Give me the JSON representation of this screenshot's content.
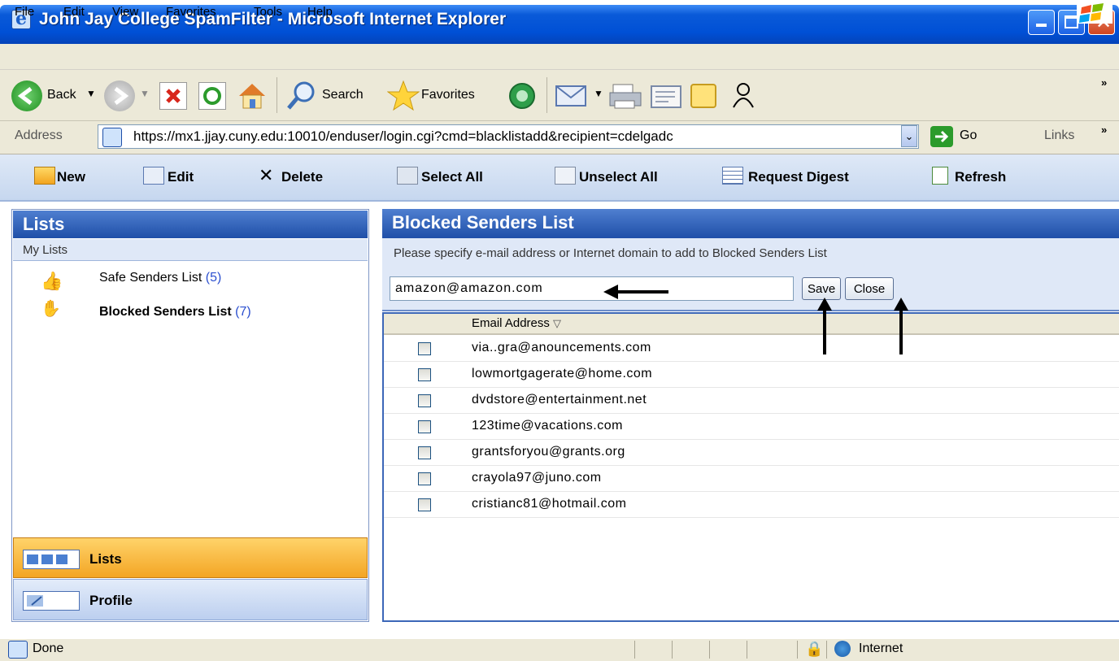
{
  "window": {
    "title": "John Jay College SpamFilter - Microsoft Internet Explorer"
  },
  "menu": [
    "File",
    "Edit",
    "View",
    "Favorites",
    "Tools",
    "Help"
  ],
  "toolbar": {
    "back": "Back",
    "search": "Search",
    "favorites": "Favorites"
  },
  "address": {
    "label": "Address",
    "url": "https://mx1.jjay.cuny.edu:10010/enduser/login.cgi?cmd=blacklistadd&recipient=cdelgadc",
    "go": "Go",
    "links": "Links"
  },
  "app_toolbar": {
    "new": "New",
    "edit": "Edit",
    "delete": "Delete",
    "select_all": "Select All",
    "unselect_all": "Unselect All",
    "request_digest": "Request Digest",
    "refresh": "Refresh"
  },
  "left": {
    "header": "Lists",
    "section": "My Lists",
    "safe_label": "Safe Senders List",
    "safe_count": "(5)",
    "blocked_label": "Blocked Senders List",
    "blocked_count": "(7)",
    "nav_lists": "Lists",
    "nav_profile": "Profile"
  },
  "right": {
    "header": "Blocked Senders List",
    "instructions": "Please specify e-mail address or Internet domain to add to Blocked Senders List",
    "input_value": "amazon@amazon.com",
    "save": "Save",
    "close": "Close",
    "column": "Email Address",
    "emails": [
      "via..gra@anouncements.com",
      "lowmortgagerate@home.com",
      "dvdstore@entertainment.net",
      "123time@vacations.com",
      "grantsforyou@grants.org",
      "crayola97@juno.com",
      "cristianc81@hotmail.com"
    ]
  },
  "status": {
    "text": "Done",
    "zone": "Internet"
  }
}
